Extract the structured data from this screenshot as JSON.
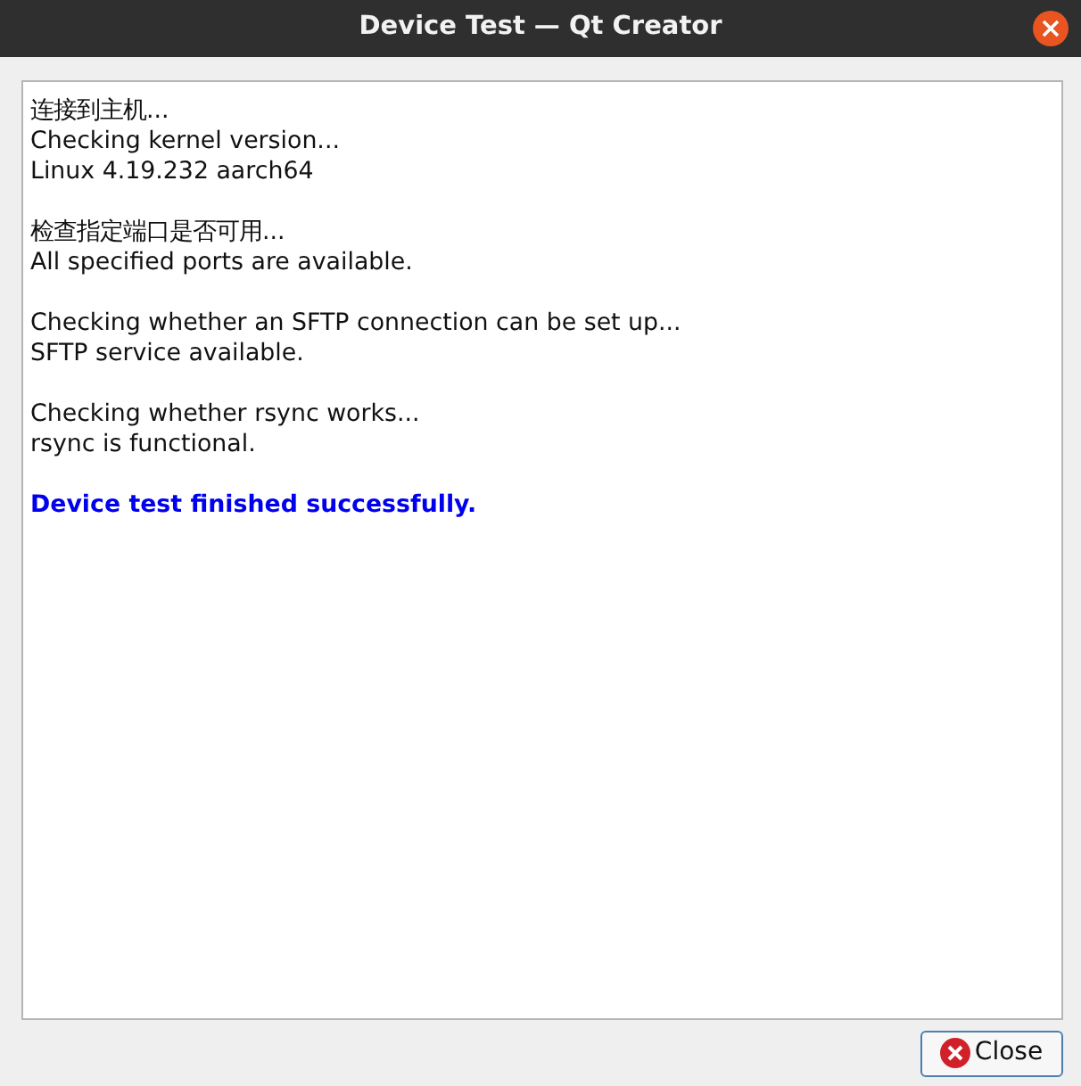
{
  "window": {
    "title": "Device Test — Qt Creator"
  },
  "log": [
    {
      "kind": "normal",
      "lines": [
        "连接到主机...",
        "Checking kernel version...",
        "Linux 4.19.232 aarch64"
      ]
    },
    {
      "kind": "normal",
      "lines": [
        "检查指定端口是否可用...",
        "All specified ports are available."
      ]
    },
    {
      "kind": "normal",
      "lines": [
        "Checking whether an SFTP connection can be set up...",
        "SFTP service available."
      ]
    },
    {
      "kind": "normal",
      "lines": [
        "Checking whether rsync works...",
        "rsync is functional."
      ]
    },
    {
      "kind": "success",
      "lines": [
        "Device test finished successfully."
      ]
    }
  ],
  "buttons": [
    {
      "label": "Close"
    }
  ]
}
